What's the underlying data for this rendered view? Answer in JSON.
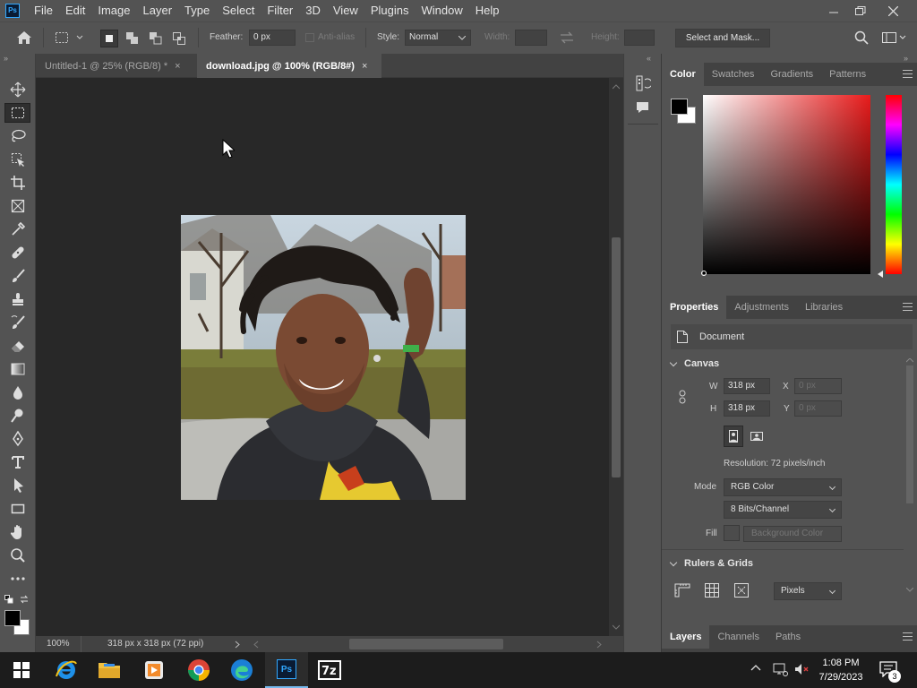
{
  "app": {
    "logo_text": "Ps",
    "logo_color": "#31a8ff"
  },
  "menus": [
    "File",
    "Edit",
    "Image",
    "Layer",
    "Type",
    "Select",
    "Filter",
    "3D",
    "View",
    "Plugins",
    "Window",
    "Help"
  ],
  "options": {
    "feather_label": "Feather:",
    "feather_value": "0 px",
    "antialias_label": "Anti-alias",
    "style_label": "Style:",
    "style_value": "Normal",
    "width_label": "Width:",
    "height_label": "Height:",
    "select_mask_label": "Select and Mask..."
  },
  "tabs": [
    {
      "label": "Untitled-1 @ 25% (RGB/8) *",
      "active": false
    },
    {
      "label": "download.jpg @ 100% (RGB/8#)",
      "active": true
    }
  ],
  "status": {
    "zoom": "100%",
    "doc_info": "318 px x 318 px (72 ppi)"
  },
  "color_panel": {
    "tabs": [
      "Color",
      "Swatches",
      "Gradients",
      "Patterns"
    ],
    "foreground": "#000000",
    "background": "#ffffff",
    "hue_color": "#e81b1b"
  },
  "properties": {
    "tabs": [
      "Properties",
      "Adjustments",
      "Libraries"
    ],
    "type_label": "Document",
    "canvas_title": "Canvas",
    "w_label": "W",
    "w_value": "318 px",
    "h_label": "H",
    "h_value": "318 px",
    "x_label": "X",
    "x_value": "0 px",
    "y_label": "Y",
    "y_value": "0 px",
    "resolution": "Resolution: 72 pixels/inch",
    "mode_label": "Mode",
    "mode_value": "RGB Color",
    "bits_value": "8 Bits/Channel",
    "fill_label": "Fill",
    "fill_value": "Background Color",
    "rulers_title": "Rulers & Grids",
    "units_value": "Pixels"
  },
  "layers_panel": {
    "tabs": [
      "Layers",
      "Channels",
      "Paths"
    ]
  },
  "taskbar": {
    "apps": [
      "internet-explorer",
      "file-explorer",
      "media-player",
      "chrome",
      "edge",
      "photoshop",
      "7zip"
    ],
    "time": "1:08 PM",
    "date": "7/29/2023",
    "notifications": "3"
  }
}
